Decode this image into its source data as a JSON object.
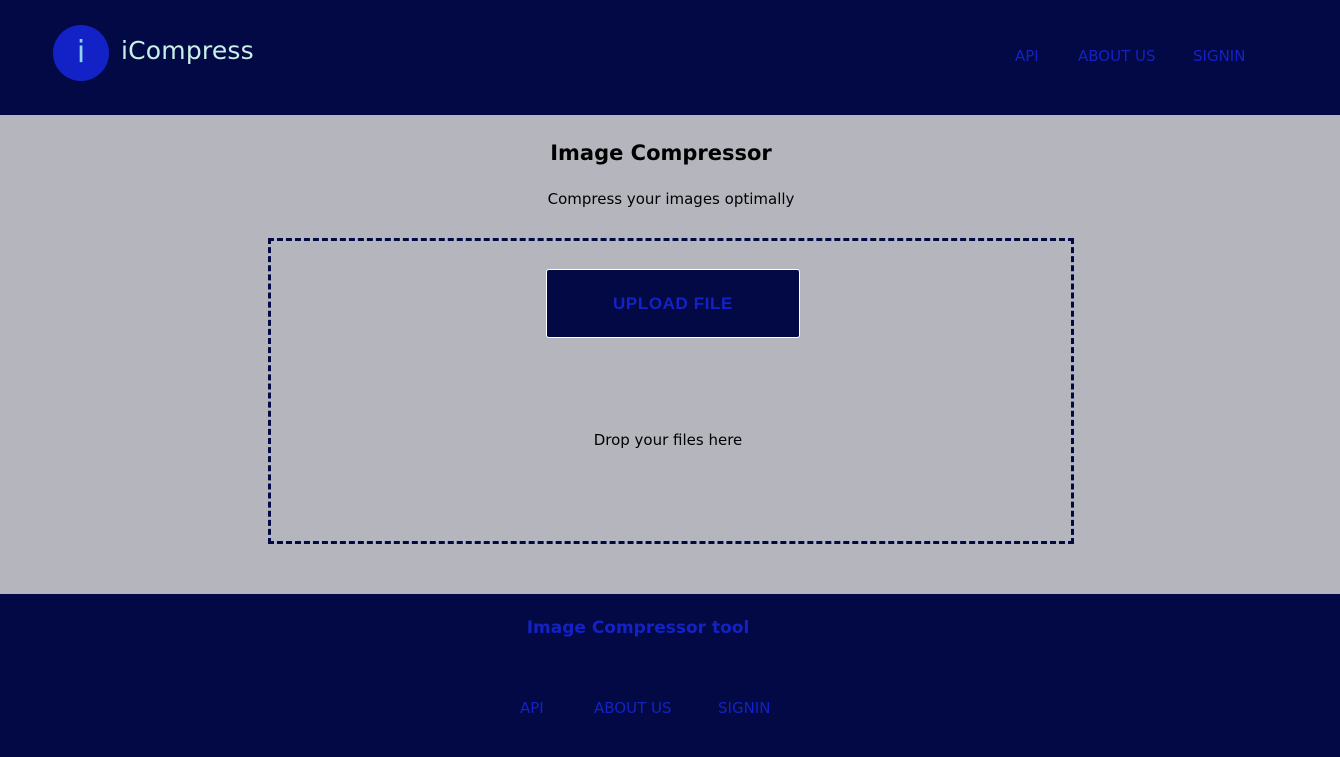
{
  "brand": {
    "logo_letter": "i",
    "name": "iCompress"
  },
  "nav": {
    "items": [
      {
        "label": "API"
      },
      {
        "label": "ABOUT US"
      },
      {
        "label": "SIGNIN"
      }
    ]
  },
  "main": {
    "title": "Image Compressor",
    "subtitle": "Compress your images optimally",
    "upload_button": "UPLOAD FILE",
    "drop_text": "Drop your files here"
  },
  "footer": {
    "title": "Image Compressor tool",
    "links": [
      {
        "label": "API"
      },
      {
        "label": "ABOUT US"
      },
      {
        "label": "SIGNIN"
      }
    ]
  },
  "colors": {
    "navy": "#030944",
    "accent_blue": "#1322c6",
    "page_gray": "#b5b5be",
    "logo_text": "#c8f0e6"
  }
}
